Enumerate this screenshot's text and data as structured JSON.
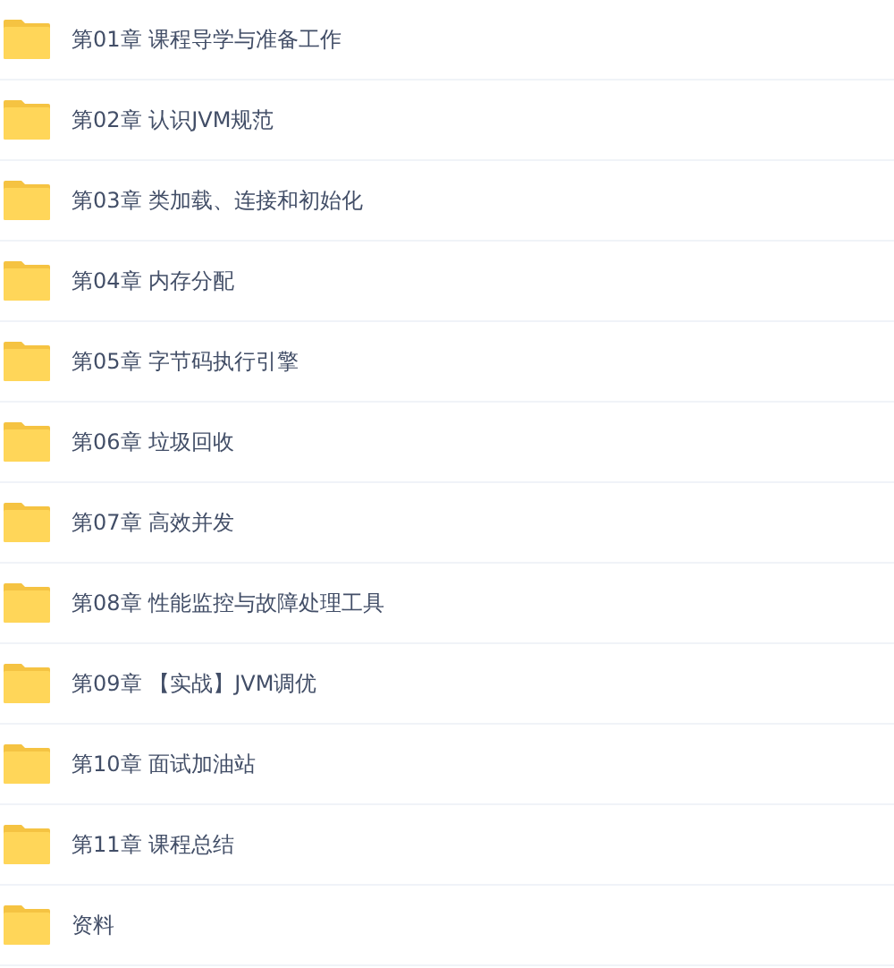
{
  "files": [
    {
      "name": "第01章 课程导学与准备工作"
    },
    {
      "name": "第02章 认识JVM规范"
    },
    {
      "name": "第03章 类加载、连接和初始化"
    },
    {
      "name": "第04章 内存分配"
    },
    {
      "name": "第05章 字节码执行引擎"
    },
    {
      "name": "第06章 垃圾回收"
    },
    {
      "name": "第07章 高效并发"
    },
    {
      "name": "第08章 性能监控与故障处理工具"
    },
    {
      "name": "第09章 【实战】JVM调优"
    },
    {
      "name": "第10章 面试加油站"
    },
    {
      "name": "第11章 课程总结"
    },
    {
      "name": "资料"
    }
  ]
}
